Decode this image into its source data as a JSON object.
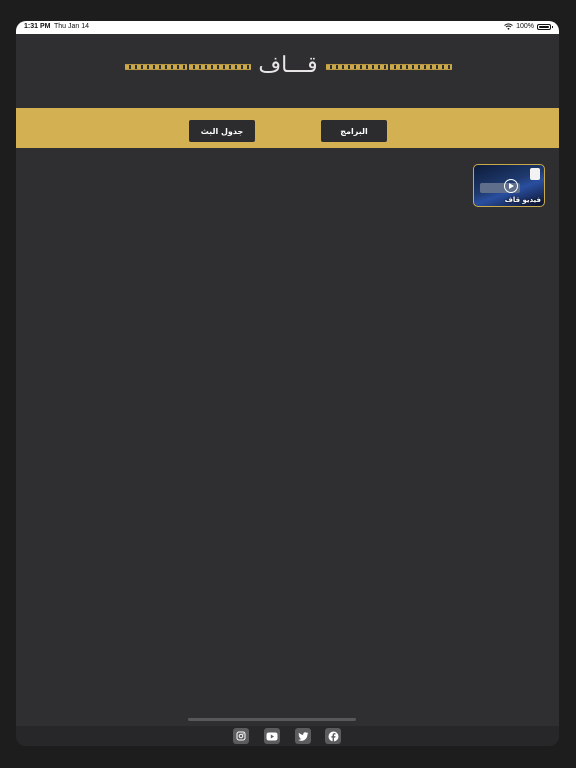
{
  "status_bar": {
    "time": "1:31 PM",
    "date": "Thu Jan 14",
    "battery": "100%"
  },
  "header": {
    "logo_text": "قـــاف"
  },
  "nav": {
    "programs_label": "البرامج",
    "schedule_label": "جدول البث"
  },
  "content": {
    "video_caption": "فيديو قاف"
  },
  "footer": {
    "icons": [
      "instagram-icon",
      "youtube-icon",
      "twitter-icon",
      "facebook-icon"
    ]
  },
  "colors": {
    "accent": "#d3b152",
    "background": "#2f2e30",
    "button": "#2c2b2d"
  }
}
